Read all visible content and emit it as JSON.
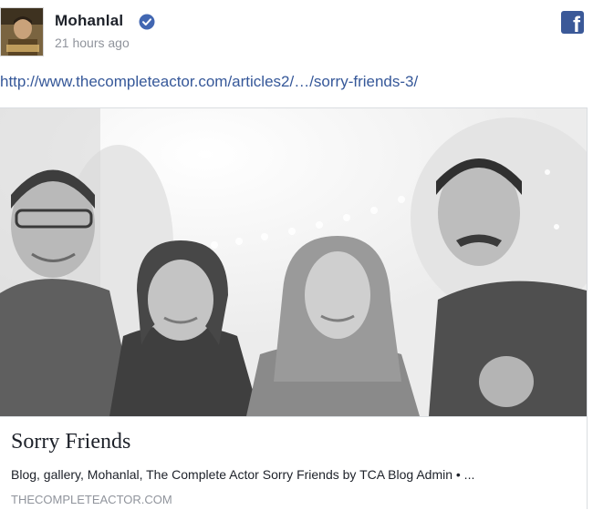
{
  "post": {
    "author": "Mohanlal",
    "verified": true,
    "timestamp": "21 hours ago",
    "link_url": "http://www.thecompleteactor.com/articles2/…/sorry-friends-3/",
    "platform_icon": "facebook-icon",
    "accent_color": "#3b5998",
    "link_color": "#365899"
  },
  "card": {
    "title": "Sorry Friends",
    "description": "Blog, gallery, Mohanlal, The Complete Actor Sorry Friends by TCA Blog Admin • ...",
    "domain": "THECOMPLETEACTOR.COM",
    "image_icon": "group-photo-image"
  }
}
